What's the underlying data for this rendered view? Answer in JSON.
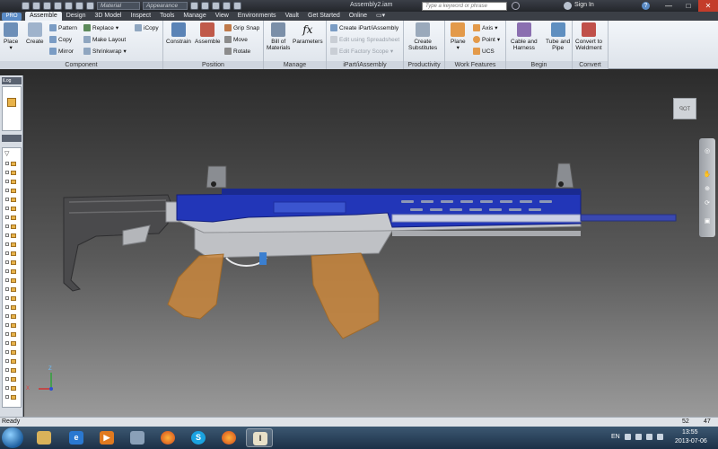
{
  "titlebar": {
    "material_placeholder": "Material",
    "appearance_placeholder": "Appearance",
    "doc_title": "Assembly2.iam",
    "search_placeholder": "Type a keyword or phrase",
    "signin": "Sign In",
    "min": "—",
    "max": "□",
    "close": "✕"
  },
  "tabs": {
    "file": "PRO",
    "items": [
      "Assemble",
      "Design",
      "3D Model",
      "Inspect",
      "Tools",
      "Manage",
      "View",
      "Environments",
      "Vault",
      "Get Started",
      "Online"
    ],
    "active": "Assemble"
  },
  "ribbon": {
    "component": {
      "title": "Component",
      "place": "Place",
      "create": "Create",
      "pattern": "Pattern",
      "copy": "Copy",
      "mirror": "Mirror",
      "replace": "Replace",
      "make_layout": "Make Layout",
      "shrinkwrap": "Shrinkwrap",
      "icopy": "iCopy"
    },
    "position": {
      "title": "Position",
      "constrain": "Constrain",
      "assemble": "Assemble",
      "grip_snap": "Grip Snap",
      "move": "Move",
      "rotate": "Rotate"
    },
    "manage": {
      "title": "Manage",
      "bom_line1": "Bill of",
      "bom_line2": "Materials",
      "parameters": "Parameters"
    },
    "ipart": {
      "title": "iPart/iAssembly",
      "create": "Create iPart/iAssembly",
      "edit_spreadsheet": "Edit using Spreadsheet",
      "edit_scope": "Edit Factory Scope"
    },
    "productivity": {
      "title": "Productivity",
      "line1": "Create",
      "line2": "Substitutes"
    },
    "work_features": {
      "title": "Work Features",
      "plane": "Plane",
      "axis": "Axis",
      "point": "Point",
      "ucs": "UCS"
    },
    "begin": {
      "title": "Begin",
      "cable_line1": "Cable and",
      "cable_line2": "Harness",
      "tube_line1": "Tube and",
      "tube_line2": "Pipe"
    },
    "convert": {
      "title": "Convert",
      "line1": "Convert to",
      "line2": "Weldment"
    }
  },
  "browser": {
    "header": "iLog"
  },
  "viewport": {
    "viewcube_label": "TOP",
    "axis_x": "X",
    "axis_z": "Z"
  },
  "status": {
    "text": "Ready",
    "n1": "52",
    "n2": "47"
  },
  "taskbar": {
    "language": "EN",
    "time": "13:55",
    "date": "2013-07-06"
  },
  "colors": {
    "rail_blue": "#2236b8",
    "magazine_orange": "#c9863c",
    "body_gray": "#c7c9cd"
  }
}
